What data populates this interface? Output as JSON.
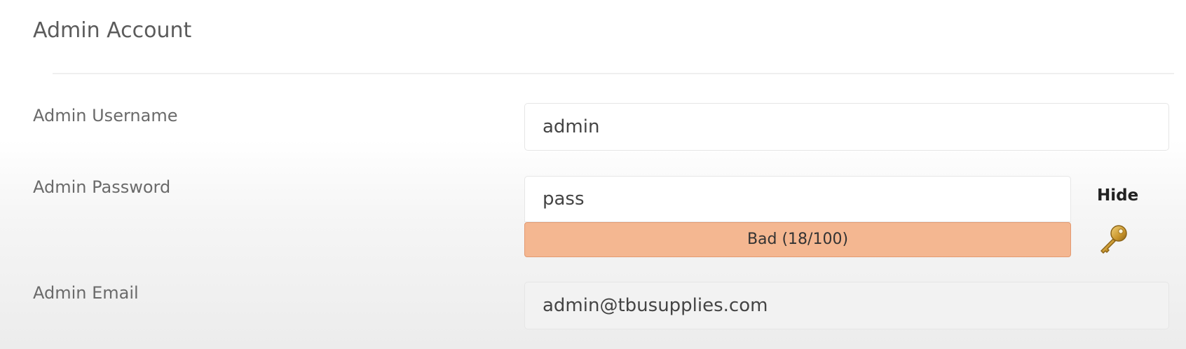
{
  "section": {
    "title": "Admin Account"
  },
  "fields": {
    "username": {
      "label": "Admin Username",
      "value": "admin"
    },
    "password": {
      "label": "Admin Password",
      "value": "pass",
      "toggle_label": "Hide",
      "strength": {
        "label": "Bad (18/100)",
        "score": 18,
        "max": 100,
        "color": "#f4b791",
        "border_color": "#e39a72"
      },
      "generate_icon": "key-icon"
    },
    "email": {
      "label": "Admin Email",
      "value": "admin@tbusupplies.com"
    }
  }
}
